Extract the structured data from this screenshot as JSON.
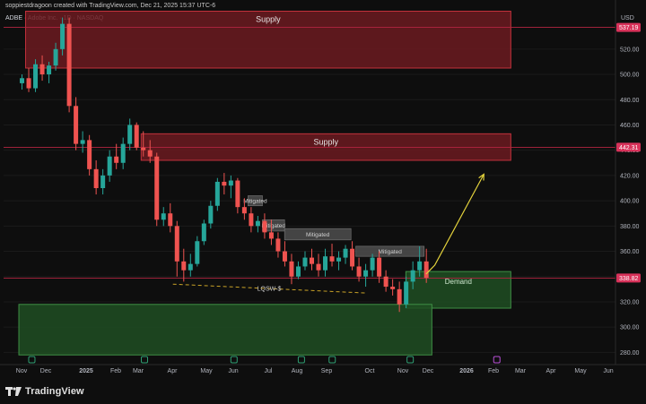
{
  "header": {
    "credit": "soppiestdragoon created with TradingView.com, Dec 21, 2025 15:37 UTC-6",
    "symbol": "ADBE · Adobe Inc. · 1D · NASDAQ"
  },
  "brand": {
    "logo_text": "TradingView"
  },
  "colors": {
    "background": "#0e0e0e",
    "candle_up": "#26a69a",
    "candle_down": "#ef5350",
    "supply_fill": "#6b1a20",
    "supply_border": "#c2323c",
    "demand_fill": "#1e4d22",
    "demand_border": "#3f8f45",
    "price_line": "#b32540",
    "projection": "#e3d23c",
    "liquidity_line": "#c9a227",
    "mitigated_box": "#4a4a4a"
  },
  "chart_data": {
    "type": "candlestick",
    "title": "ADBE · Adobe Inc. · 1D · NASDAQ",
    "y_axis_label": "USD",
    "ylim": [
      270,
      550
    ],
    "x_tick_labels": [
      "Nov",
      "Dec",
      "2025",
      "Feb",
      "Mar",
      "Apr",
      "May",
      "Jun",
      "Jul",
      "Aug",
      "Sep",
      "Oct",
      "Nov",
      "Dec",
      "2026",
      "Feb",
      "Mar",
      "Apr",
      "May",
      "Jun"
    ],
    "y_tick_labels": [
      280,
      300,
      320,
      340,
      360,
      380,
      400,
      420,
      440,
      460,
      480,
      500,
      520
    ],
    "price_tags": [
      {
        "value": 537.19,
        "label": "537.19"
      },
      {
        "value": 442.31,
        "label": "442.31"
      },
      {
        "value": 338.82,
        "label": "338.82"
      }
    ],
    "zones": [
      {
        "name": "Supply",
        "kind": "supply",
        "top": 550,
        "bottom": 505,
        "start": "2024-11-01",
        "end": "2026-03-20"
      },
      {
        "name": "Supply",
        "kind": "supply",
        "top": 453,
        "bottom": 432,
        "start": "2025-03-01",
        "end": "2026-03-20"
      },
      {
        "name": "Demand",
        "kind": "demand",
        "top": 344,
        "bottom": 315,
        "start": "2025-12-01",
        "end": "2026-03-20"
      },
      {
        "name": "",
        "kind": "demand",
        "top": 318,
        "bottom": 278,
        "start": "2024-10-25",
        "end": "2025-12-28"
      }
    ],
    "mitigated_boxes": [
      {
        "label": "Mitigated",
        "top": 404,
        "bottom": 396,
        "start": "2025-06-20",
        "end": "2025-07-05"
      },
      {
        "label": "Mitigated",
        "top": 385,
        "bottom": 376,
        "start": "2025-07-05",
        "end": "2025-07-28"
      },
      {
        "label": "Mitigated",
        "top": 378,
        "bottom": 369,
        "start": "2025-07-28",
        "end": "2025-10-05"
      },
      {
        "label": "Mitigated",
        "top": 364,
        "bottom": 356,
        "start": "2025-10-10",
        "end": "2025-12-20"
      }
    ],
    "liquidity_sweep": {
      "label": "LQSW-$",
      "points": [
        [
          "2025-04-03",
          334
        ],
        [
          "2025-10-20",
          327
        ]
      ]
    },
    "projection": {
      "points": [
        [
          "2025-12-22",
          342
        ],
        [
          "2025-12-31",
          349
        ],
        [
          "2026-02-20",
          421
        ]
      ]
    },
    "events": [
      "2024-11-07",
      "2025-03-04",
      "2025-06-05",
      "2025-08-14",
      "2025-09-15",
      "2025-12-05",
      "2026-03-05"
    ],
    "ohlc_summary": [
      [
        "2024-10-25",
        493,
        500,
        488,
        497
      ],
      [
        "2024-11-01",
        497,
        505,
        486,
        489
      ],
      [
        "2024-11-08",
        489,
        512,
        486,
        508
      ],
      [
        "2024-11-15",
        508,
        515,
        495,
        500
      ],
      [
        "2024-11-22",
        500,
        510,
        493,
        507
      ],
      [
        "2024-11-29",
        507,
        525,
        503,
        520
      ],
      [
        "2024-12-06",
        520,
        545,
        515,
        540
      ],
      [
        "2024-12-13",
        540,
        545,
        470,
        475
      ],
      [
        "2024-12-20",
        475,
        482,
        440,
        445
      ],
      [
        "2024-12-27",
        445,
        455,
        438,
        448
      ],
      [
        "2025-01-03",
        448,
        452,
        420,
        425
      ],
      [
        "2025-01-10",
        425,
        432,
        405,
        410
      ],
      [
        "2025-01-17",
        410,
        425,
        405,
        420
      ],
      [
        "2025-01-24",
        420,
        440,
        415,
        435
      ],
      [
        "2025-01-31",
        435,
        445,
        425,
        430
      ],
      [
        "2025-02-07",
        430,
        450,
        425,
        445
      ],
      [
        "2025-02-14",
        445,
        465,
        440,
        460
      ],
      [
        "2025-02-21",
        460,
        462,
        440,
        442
      ],
      [
        "2025-02-28",
        442,
        455,
        435,
        440
      ],
      [
        "2025-03-07",
        440,
        448,
        430,
        435
      ],
      [
        "2025-03-14",
        435,
        438,
        380,
        385
      ],
      [
        "2025-03-21",
        385,
        395,
        380,
        390
      ],
      [
        "2025-03-28",
        390,
        398,
        375,
        380
      ],
      [
        "2025-04-04",
        380,
        384,
        340,
        352
      ],
      [
        "2025-04-11",
        352,
        362,
        336,
        345
      ],
      [
        "2025-04-18",
        345,
        358,
        340,
        350
      ],
      [
        "2025-04-25",
        350,
        372,
        348,
        368
      ],
      [
        "2025-05-02",
        368,
        385,
        365,
        382
      ],
      [
        "2025-05-09",
        382,
        400,
        378,
        396
      ],
      [
        "2025-05-16",
        396,
        418,
        392,
        415
      ],
      [
        "2025-05-23",
        415,
        422,
        405,
        412
      ],
      [
        "2025-05-30",
        412,
        420,
        402,
        416
      ],
      [
        "2025-06-06",
        416,
        418,
        390,
        395
      ],
      [
        "2025-06-13",
        395,
        402,
        385,
        390
      ],
      [
        "2025-06-20",
        390,
        395,
        375,
        380
      ],
      [
        "2025-06-27",
        380,
        388,
        375,
        384
      ],
      [
        "2025-07-04",
        384,
        390,
        370,
        375
      ],
      [
        "2025-07-11",
        375,
        385,
        365,
        370
      ],
      [
        "2025-07-18",
        370,
        375,
        355,
        360
      ],
      [
        "2025-07-25",
        360,
        368,
        348,
        352
      ],
      [
        "2025-08-01",
        352,
        358,
        334,
        340
      ],
      [
        "2025-08-08",
        340,
        352,
        338,
        348
      ],
      [
        "2025-08-15",
        348,
        360,
        345,
        355
      ],
      [
        "2025-08-22",
        355,
        362,
        345,
        350
      ],
      [
        "2025-08-29",
        350,
        358,
        340,
        345
      ],
      [
        "2025-09-05",
        345,
        362,
        340,
        356
      ],
      [
        "2025-09-12",
        356,
        366,
        348,
        352
      ],
      [
        "2025-09-19",
        352,
        360,
        345,
        355
      ],
      [
        "2025-09-26",
        355,
        365,
        350,
        362
      ],
      [
        "2025-10-03",
        362,
        368,
        345,
        348
      ],
      [
        "2025-10-10",
        348,
        355,
        336,
        340
      ],
      [
        "2025-10-17",
        340,
        350,
        332,
        345
      ],
      [
        "2025-10-24",
        345,
        358,
        340,
        355
      ],
      [
        "2025-10-31",
        355,
        360,
        335,
        340
      ],
      [
        "2025-11-07",
        340,
        345,
        328,
        332
      ],
      [
        "2025-11-14",
        332,
        338,
        325,
        330
      ],
      [
        "2025-11-21",
        330,
        336,
        312,
        318
      ],
      [
        "2025-11-28",
        318,
        340,
        315,
        336
      ],
      [
        "2025-12-05",
        336,
        352,
        330,
        345
      ],
      [
        "2025-12-12",
        345,
        364,
        340,
        352
      ],
      [
        "2025-12-19",
        352,
        362,
        335,
        339
      ]
    ]
  }
}
